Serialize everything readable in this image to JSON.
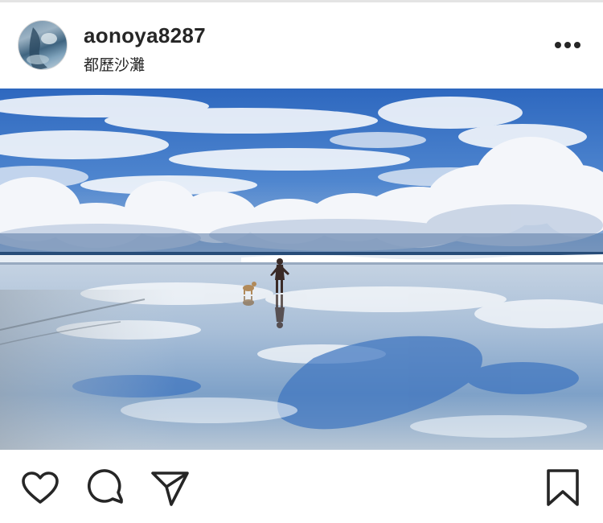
{
  "post": {
    "username": "aonoya8287",
    "location": "都歷沙灘"
  },
  "icons": {
    "more": "more-options-icon",
    "like": "heart-icon",
    "comment": "comment-bubble-icon",
    "share": "paper-plane-icon",
    "save": "bookmark-icon"
  },
  "colors": {
    "text": "#262626",
    "sky_blue": "#2f6fc4",
    "divider": "#e4e4e4"
  }
}
